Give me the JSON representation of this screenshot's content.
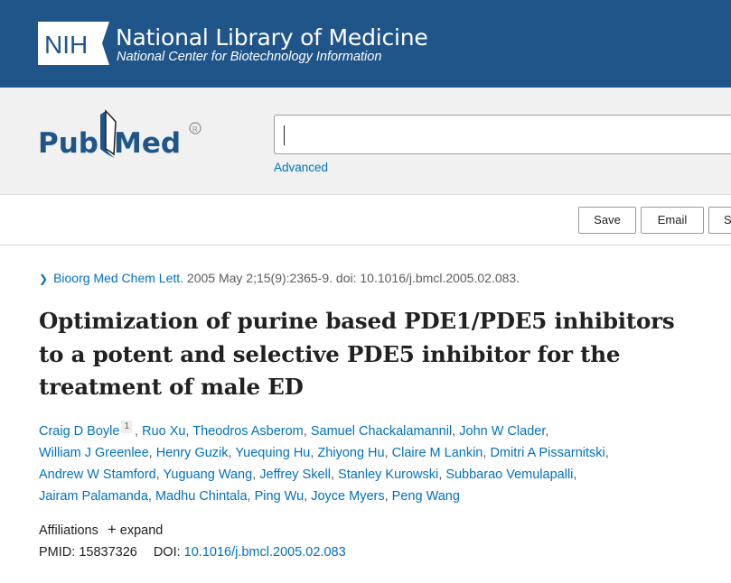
{
  "header": {
    "logo_text": "NIH",
    "title": "National Library of Medicine",
    "subtitle": "National Center for Biotechnology Information"
  },
  "search": {
    "logo_text": "PubMed",
    "value": "",
    "advanced_label": "Advanced"
  },
  "actions": {
    "save_label": "Save",
    "email_label": "Email",
    "send_label": "S"
  },
  "article": {
    "journal": "Bioorg Med Chem Lett.",
    "citation_detail": " 2005 May 2;15(9):2365-9. doi: 10.1016/j.bmcl.2005.02.083.",
    "title": "Optimization of purine based PDE1/PDE5 inhibitors to a potent and selective PDE5 inhibitor for the treatment of male ED",
    "author_lines": [
      [
        "Craig D Boyle",
        "Ruo Xu",
        "Theodros Asberom",
        "Samuel Chackalamannil",
        "John W Clader"
      ],
      [
        "William J Greenlee",
        "Henry Guzik",
        "Yuequing Hu",
        "Zhiyong Hu",
        "Claire M Lankin",
        "Dmitri A Pissarnitski"
      ],
      [
        "Andrew W Stamford",
        "Yuguang Wang",
        "Jeffrey Skell",
        "Stanley Kurowski",
        "Subbarao Vemulapalli"
      ],
      [
        "Jairam Palamanda",
        "Madhu Chintala",
        "Ping Wu",
        "Joyce Myers",
        "Peng Wang"
      ]
    ],
    "first_author_affiliation_ref": "1",
    "affiliations_label": "Affiliations",
    "expand_label": "expand",
    "pmid_label": "PMID: ",
    "pmid": "15837326",
    "doi_label": "DOI: ",
    "doi": "10.1016/j.bmcl.2005.02.083"
  },
  "colors": {
    "header_bg": "#20558a",
    "link": "#0071bc",
    "search_band_bg": "#f1f1f1"
  }
}
